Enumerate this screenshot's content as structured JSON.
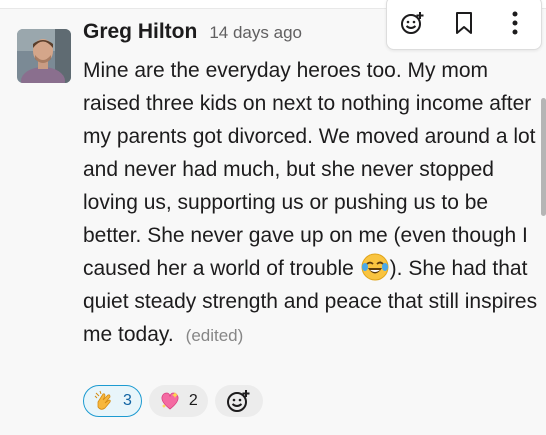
{
  "message": {
    "author": "Greg Hilton",
    "timestamp": "14 days ago",
    "text_part1": "Mine are the everyday heroes too.  My mom raised three kids on next to nothing income after my parents got divorced.  We moved around a lot and never had much, but she never stopped loving us, supporting us or pushing us to be better.  She never gave up on me (even though I caused her a world of trouble ",
    "inline_emoji": "joy-emoji",
    "text_part2": ").  She had that quiet steady strength and peace that still inspires me today.",
    "edited_label": "(edited)"
  },
  "reactions": [
    {
      "emoji": "clapping-hands",
      "count": "3",
      "selected": true
    },
    {
      "emoji": "sparkling-heart",
      "count": "2",
      "selected": false
    }
  ],
  "add_reaction_icon": "add-reaction-icon",
  "toolbar": {
    "icons": [
      "add-reaction-icon",
      "bookmark-icon",
      "more-actions-icon"
    ]
  },
  "colors": {
    "accent": "#1d9bd1",
    "selected_reaction_bg": "#e8f5fa",
    "text": "#1d1c1d",
    "muted": "#616061"
  }
}
